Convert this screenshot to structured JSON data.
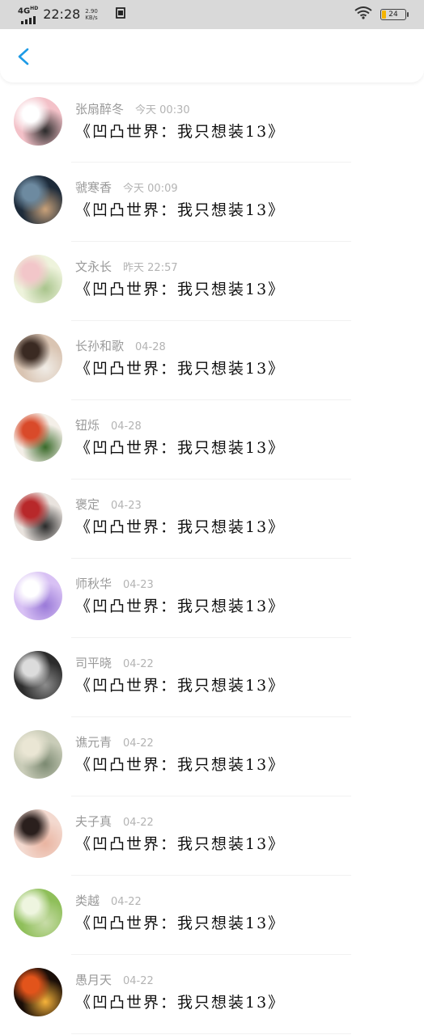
{
  "status_bar": {
    "network": "4G",
    "network_sup": "HD",
    "time": "22:28",
    "speed_value": "2.90",
    "speed_unit": "KB/s",
    "sim_icon": "sim-icon",
    "wifi_icon": "wifi-icon",
    "battery_level": "24",
    "battery_color": "#f4b400"
  },
  "header": {
    "back_icon": "chevron-left-icon",
    "accent": "#1e9be6"
  },
  "contacts": [
    {
      "name": "张扇醉冬",
      "time": "今天 00:30",
      "message": "《凹凸世界：我只想装13》",
      "avatar_colors": [
        "#f3c1c8",
        "#ffffff",
        "#2b2b2b"
      ]
    },
    {
      "name": "虢寒香",
      "time": "今天 00:09",
      "message": "《凹凸世界：我只想装13》",
      "avatar_colors": [
        "#1d2b3a",
        "#6d8aa0",
        "#c9a27a"
      ]
    },
    {
      "name": "文永长",
      "time": "昨天 22:57",
      "message": "《凹凸世界：我只想装13》",
      "avatar_colors": [
        "#eef3dc",
        "#f2c6c9",
        "#a9c48c"
      ]
    },
    {
      "name": "长孙和歌",
      "time": "04-28",
      "message": "《凹凸世界：我只想装13》",
      "avatar_colors": [
        "#d9c4b2",
        "#3a2a22",
        "#f0ece6"
      ]
    },
    {
      "name": "钮烁",
      "time": "04-28",
      "message": "《凹凸世界：我只想装13》",
      "avatar_colors": [
        "#f4efe8",
        "#d94a2a",
        "#3a6a2a"
      ]
    },
    {
      "name": "褒定",
      "time": "04-23",
      "message": "《凹凸世界：我只想装13》",
      "avatar_colors": [
        "#e9e3de",
        "#b8282a",
        "#2a2a2a"
      ]
    },
    {
      "name": "师秋华",
      "time": "04-23",
      "message": "《凹凸世界：我只想装13》",
      "avatar_colors": [
        "#d8c1f4",
        "#ffffff",
        "#9a7ad8"
      ]
    },
    {
      "name": "司平晓",
      "time": "04-22",
      "message": "《凹凸世界：我只想装13》",
      "avatar_colors": [
        "#2c2c2c",
        "#dcdcdc",
        "#8c8c8c"
      ]
    },
    {
      "name": "谯元青",
      "time": "04-22",
      "message": "《凹凸世界：我只想装13》",
      "avatar_colors": [
        "#c9ccb8",
        "#eae6d4",
        "#7c8a72"
      ]
    },
    {
      "name": "夫子真",
      "time": "04-22",
      "message": "《凹凸世界：我只想装13》",
      "avatar_colors": [
        "#f3d9cf",
        "#2a1f1d",
        "#e9b4a1"
      ]
    },
    {
      "name": "类越",
      "time": "04-22",
      "message": "《凹凸世界：我只想装13》",
      "avatar_colors": [
        "#8fbf5a",
        "#eef5df",
        "#c8dca8"
      ]
    },
    {
      "name": "愚月天",
      "time": "04-22",
      "message": "《凹凸世界：我只想装13》",
      "avatar_colors": [
        "#1a0e08",
        "#e2541b",
        "#f7b33a"
      ]
    }
  ]
}
